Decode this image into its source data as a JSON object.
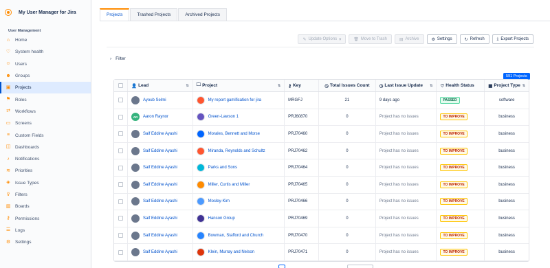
{
  "app": {
    "name": "My User Manager for Jira"
  },
  "sidebar": {
    "section": "User Management",
    "items": [
      {
        "label": "Home",
        "icon": "home-icon"
      },
      {
        "label": "System health",
        "icon": "heart-icon"
      },
      {
        "label": "Users",
        "icon": "user-icon"
      },
      {
        "label": "Groups",
        "icon": "group-icon"
      },
      {
        "label": "Projects",
        "icon": "folder-icon"
      },
      {
        "label": "Roles",
        "icon": "role-icon"
      },
      {
        "label": "Workflows",
        "icon": "workflow-icon"
      },
      {
        "label": "Screens",
        "icon": "screen-icon"
      },
      {
        "label": "Custom Fields",
        "icon": "field-icon"
      },
      {
        "label": "Dashboards",
        "icon": "dashboard-icon"
      },
      {
        "label": "Notifications",
        "icon": "bell-icon"
      },
      {
        "label": "Priorities",
        "icon": "priority-icon"
      },
      {
        "label": "Issue Types",
        "icon": "issue-type-icon"
      },
      {
        "label": "Filters",
        "icon": "filter-icon"
      },
      {
        "label": "Boards",
        "icon": "board-icon"
      },
      {
        "label": "Permissions",
        "icon": "key-icon"
      },
      {
        "label": "Logs",
        "icon": "log-icon"
      },
      {
        "label": "Settings",
        "icon": "gear-icon"
      }
    ],
    "active": "Projects"
  },
  "tabs": [
    "Projects",
    "Trashed Projects",
    "Archived Projects"
  ],
  "toolbar": {
    "update_options": "Update Options",
    "move_to_trash": "Move to Trash",
    "archive": "Archive",
    "settings": "Settings",
    "refresh": "Refresh",
    "export": "Export Projects"
  },
  "filter": {
    "label": "Filter"
  },
  "count_badge": "591 Projects",
  "table": {
    "headers": {
      "lead": "Lead",
      "project": "Project",
      "key": "Key",
      "total": "Total Issues Count",
      "last": "Last Issue Update",
      "health": "Health Status",
      "type": "Project Type"
    },
    "rows": [
      {
        "lead": "Ayoub Selmi",
        "initials": "",
        "project": "My report gamification for jira",
        "key": "MRGFJ",
        "total": "21",
        "last": "9 days ago",
        "health": "PASSED",
        "type": "software",
        "proj_color": "#ff5630"
      },
      {
        "lead": "Aaron Raynor",
        "initials": "AR",
        "project": "Green-Lawson 1",
        "key": "PRJ60870",
        "total": "0",
        "last": "Project has no issues",
        "health": "TO IMPROVE",
        "type": "business",
        "proj_color": "#6554c0"
      },
      {
        "lead": "Saif Eddine Ayashi",
        "initials": "",
        "project": "Morales, Bennett and Morse",
        "key": "PRJ70460",
        "total": "0",
        "last": "Project has no issues",
        "health": "TO IMPROVE",
        "type": "business",
        "proj_color": "#0065ff"
      },
      {
        "lead": "Saif Eddine Ayashi",
        "initials": "",
        "project": "Miranda, Reynolds and Schultz",
        "key": "PRJ70462",
        "total": "0",
        "last": "Project has no issues",
        "health": "TO IMPROVE",
        "type": "business",
        "proj_color": "#ff5630"
      },
      {
        "lead": "Saif Eddine Ayashi",
        "initials": "",
        "project": "Parks and Sons",
        "key": "PRJ70464",
        "total": "0",
        "last": "Project has no issues",
        "health": "TO IMPROVE",
        "type": "business",
        "proj_color": "#00b8d9"
      },
      {
        "lead": "Saif Eddine Ayashi",
        "initials": "",
        "project": "Miller, Curtis and Miller",
        "key": "PRJ70465",
        "total": "0",
        "last": "Project has no issues",
        "health": "TO IMPROVE",
        "type": "business",
        "proj_color": "#ff8b00"
      },
      {
        "lead": "Saif Eddine Ayashi",
        "initials": "",
        "project": "Mosley-Kim",
        "key": "PRJ70466",
        "total": "0",
        "last": "Project has no issues",
        "health": "TO IMPROVE",
        "type": "business",
        "proj_color": "#4c9aff"
      },
      {
        "lead": "Saif Eddine Ayashi",
        "initials": "",
        "project": "Hanson Group",
        "key": "PRJ70469",
        "total": "0",
        "last": "Project has no issues",
        "health": "TO IMPROVE",
        "type": "business",
        "proj_color": "#403294"
      },
      {
        "lead": "Saif Eddine Ayashi",
        "initials": "",
        "project": "Bowman, Stafford and Church",
        "key": "PRJ70470",
        "total": "0",
        "last": "Project has no issues",
        "health": "TO IMPROVE",
        "type": "business",
        "proj_color": "#2684ff"
      },
      {
        "lead": "Saif Eddine Ayashi",
        "initials": "",
        "project": "Klein, Murray and Nelson",
        "key": "PRJ70471",
        "total": "0",
        "last": "Project has no issues",
        "health": "TO IMPROVE",
        "type": "business",
        "proj_color": "#de350b"
      }
    ]
  }
}
